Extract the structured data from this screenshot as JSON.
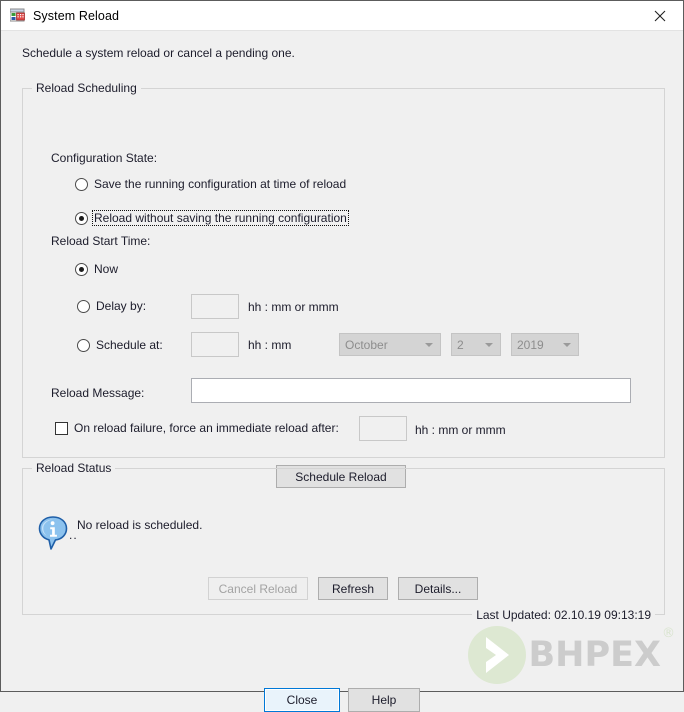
{
  "window": {
    "title": "System Reload",
    "icon": "system-reload-icon",
    "close_icon": "close-icon"
  },
  "subtitle": "Schedule a system reload or cancel a pending one.",
  "scheduling": {
    "legend": "Reload Scheduling",
    "config_state_label": "Configuration State:",
    "config_options": [
      {
        "label": "Save the running configuration at time of reload",
        "checked": false,
        "focused": false
      },
      {
        "label": "Reload without saving the running configuration",
        "checked": true,
        "focused": true
      }
    ],
    "start_time_label": "Reload Start Time:",
    "start_options": [
      {
        "label": "Now",
        "checked": true
      },
      {
        "label": "Delay by:",
        "checked": false
      },
      {
        "label": "Schedule at:",
        "checked": false
      }
    ],
    "delay_value": "",
    "delay_hint": "hh : mm or mmm",
    "schedule_value": "",
    "schedule_hint": "hh : mm",
    "month_combo": {
      "value": "October",
      "icon": "chevron-down-icon"
    },
    "day_combo": {
      "value": "2",
      "icon": "chevron-down-icon"
    },
    "year_combo": {
      "value": "2019",
      "icon": "chevron-down-icon"
    },
    "message_label": "Reload Message:",
    "message_value": "",
    "failure_checkbox_label": "On reload failure, force an immediate reload after:",
    "failure_checked": false,
    "failure_value": "",
    "failure_hint": "hh : mm or mmm",
    "schedule_button": "Schedule Reload"
  },
  "status": {
    "legend": "Reload Status",
    "info_icon": "info-icon",
    "message": "No reload is scheduled.",
    "submessage": "..",
    "cancel_button": {
      "label": "Cancel Reload",
      "enabled": false
    },
    "refresh_button": {
      "label": "Refresh",
      "enabled": true
    },
    "details_button": {
      "label": "Details...",
      "enabled": true
    },
    "last_updated": "Last Updated: 02.10.19 09:13:19"
  },
  "footer": {
    "close_button": "Close",
    "help_button": "Help"
  },
  "watermark": {
    "text": "BHPEX",
    "registered": "®",
    "logo_icon": "chevron-circle-logo-icon",
    "green": "#dde8d2",
    "gray": "#cccccc"
  }
}
